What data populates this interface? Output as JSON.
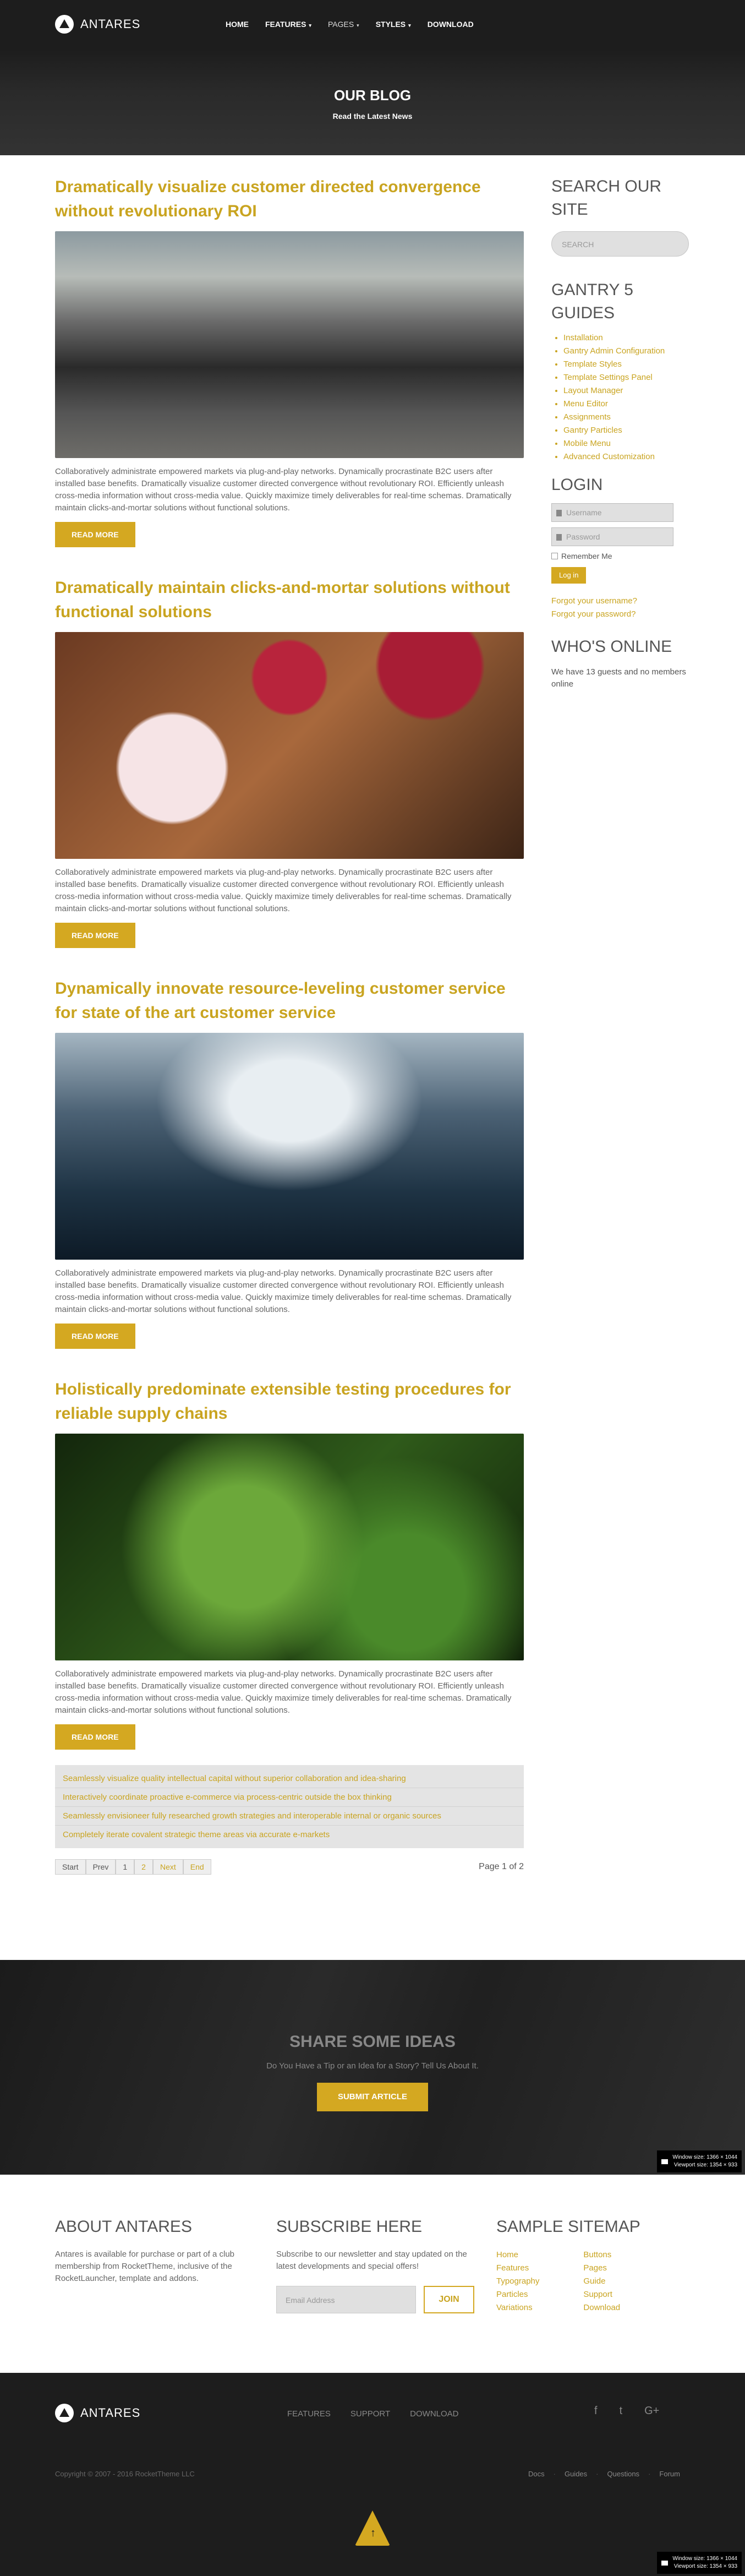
{
  "brand": {
    "name": "ANTARES"
  },
  "nav": {
    "items": [
      {
        "label": "HOME",
        "dd": ""
      },
      {
        "label": "FEATURES",
        "dd": "▾"
      },
      {
        "label": "PAGES",
        "dd": "▾"
      },
      {
        "label": "STYLES",
        "dd": "▾"
      },
      {
        "label": "DOWNLOAD",
        "dd": ""
      }
    ]
  },
  "hero": {
    "title": "OUR BLOG",
    "subtitle": "Read the Latest News"
  },
  "articles": [
    {
      "title": "Dramatically visualize customer directed convergence without revolutionary ROI",
      "body": "Collaboratively administrate empowered markets via plug-and-play networks. Dynamically procrastinate B2C users after installed base benefits. Dramatically visualize customer directed convergence without revolutionary ROI. Efficiently unleash cross-media information without cross-media value. Quickly maximize timely deliverables for real-time schemas. Dramatically maintain clicks-and-mortar solutions without functional solutions.",
      "read_more": "READ MORE"
    },
    {
      "title": "Dramatically maintain clicks-and-mortar solutions without functional solutions",
      "body": "Collaboratively administrate empowered markets via plug-and-play networks. Dynamically procrastinate B2C users after installed base benefits. Dramatically visualize customer directed convergence without revolutionary ROI. Efficiently unleash cross-media information without cross-media value. Quickly maximize timely deliverables for real-time schemas. Dramatically maintain clicks-and-mortar solutions without functional solutions.",
      "read_more": "READ MORE"
    },
    {
      "title": "Dynamically innovate resource-leveling customer service for state of the art customer service",
      "body": "Collaboratively administrate empowered markets via plug-and-play networks. Dynamically procrastinate B2C users after installed base benefits. Dramatically visualize customer directed convergence without revolutionary ROI. Efficiently unleash cross-media information without cross-media value. Quickly maximize timely deliverables for real-time schemas. Dramatically maintain clicks-and-mortar solutions without functional solutions.",
      "read_more": "READ MORE"
    },
    {
      "title": "Holistically predominate extensible testing procedures for reliable supply chains",
      "body": "Collaboratively administrate empowered markets via plug-and-play networks. Dynamically procrastinate B2C users after installed base benefits. Dramatically visualize customer directed convergence without revolutionary ROI. Efficiently unleash cross-media information without cross-media value. Quickly maximize timely deliverables for real-time schemas. Dramatically maintain clicks-and-mortar solutions without functional solutions.",
      "read_more": "READ MORE"
    }
  ],
  "more_links": [
    "Seamlessly visualize quality intellectual capital without superior collaboration and idea-sharing",
    "Interactively coordinate proactive e-commerce via process-centric outside the box thinking",
    "Seamlessly envisioneer fully researched growth strategies and interoperable internal or organic sources",
    "Completely iterate covalent strategic theme areas via accurate e-markets"
  ],
  "pagination": {
    "items": [
      "Start",
      "Prev",
      "1",
      "2",
      "Next",
      "End"
    ],
    "summary": "Page 1 of 2"
  },
  "sidebar": {
    "search_title": "SEARCH OUR SITE",
    "search_placeholder": "SEARCH",
    "guides_title": "GANTRY 5 GUIDES",
    "guides": [
      "Installation",
      "Gantry Admin Configuration",
      "Template Styles",
      "Template Settings Panel",
      "Layout Manager",
      "Menu Editor",
      "Assignments",
      "Gantry Particles",
      "Mobile Menu",
      "Advanced Customization"
    ],
    "login_title": "LOGIN",
    "username": "Username",
    "password": "Password",
    "remember": "Remember Me",
    "login_btn": "Log in",
    "forgot_user": "Forgot your username?",
    "forgot_pass": "Forgot your password?",
    "online_title": "WHO'S ONLINE",
    "online_text": "We have 13 guests and no members online"
  },
  "share": {
    "title": "SHARE SOME IDEAS",
    "text": "Do You Have a Tip or an Idea for a Story? Tell Us About It.",
    "button": "SUBMIT ARTICLE"
  },
  "window_info": {
    "line1": "Window size: 1366 × 1044",
    "line2": "Viewport size: 1354 × 933"
  },
  "footer": {
    "about_title": "ABOUT ANTARES",
    "about_text": "Antares is available for purchase or part of a club membership from RocketTheme, inclusive of the RocketLauncher, template and addons.",
    "subscribe_title": "SUBSCRIBE HERE",
    "subscribe_text": "Subscribe to our newsletter and stay updated on the latest developments and special offers!",
    "email_placeholder": "Email Address",
    "join": "JOIN",
    "sitemap_title": "SAMPLE SITEMAP",
    "sitemap_col1": [
      "Home",
      "Features",
      "Typography",
      "Particles",
      "Variations"
    ],
    "sitemap_col2": [
      "Buttons",
      "Pages",
      "Guide",
      "Support",
      "Download"
    ],
    "menu": [
      "FEATURES",
      "SUPPORT",
      "DOWNLOAD"
    ],
    "social": [
      "f",
      "t",
      "G+"
    ],
    "copyright": "Copyright © 2007 - 2016 RocketTheme LLC",
    "links": [
      "Docs",
      "Guides",
      "Questions",
      "Forum"
    ]
  }
}
